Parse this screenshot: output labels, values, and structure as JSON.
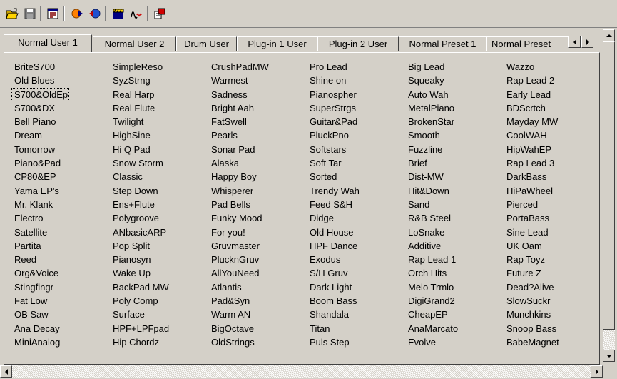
{
  "toolbar": {
    "buttons": [
      {
        "name": "open-folder-icon"
      },
      {
        "name": "save-disk-icon"
      },
      {
        "name": "properties-icon"
      },
      {
        "name": "send-icon"
      },
      {
        "name": "receive-icon"
      },
      {
        "name": "film-clapper-icon"
      },
      {
        "name": "midi-wave-icon"
      },
      {
        "name": "tools-icon"
      }
    ]
  },
  "tabs": [
    {
      "label": "Normal User 1",
      "active": true
    },
    {
      "label": "Normal User 2",
      "active": false
    },
    {
      "label": "Drum User",
      "active": false
    },
    {
      "label": "Plug-in 1 User",
      "active": false
    },
    {
      "label": "Plug-in 2 User",
      "active": false
    },
    {
      "label": "Normal Preset 1",
      "active": false
    },
    {
      "label": "Normal Preset",
      "active": false
    }
  ],
  "columns": [
    [
      "BriteS700",
      "Old Blues",
      "S700&OldEp",
      "S700&DX",
      "Bell Piano",
      "Dream",
      "Tomorrow",
      "Piano&Pad",
      "CP80&EP",
      "Yama EP's",
      "Mr. Klank",
      "Electro",
      "Satellite",
      "Partita",
      "Reed",
      "Org&Voice",
      "Stingfingr",
      "Fat Low",
      "OB Saw",
      "Ana Decay",
      "MiniAnalog"
    ],
    [
      "SimpleReso",
      "SyzStrng",
      "Real Harp",
      "Real Flute",
      "Twilight",
      "HighSine",
      "Hi Q Pad",
      "Snow Storm",
      "Classic",
      "Step Down",
      "Ens+Flute",
      "Polygroove",
      "ANbasicARP",
      "Pop Split",
      "Pianosyn",
      "Wake Up",
      "BackPad MW",
      "Poly Comp",
      "Surface",
      "HPF+LPFpad",
      "Hip Chordz"
    ],
    [
      "CrushPadMW",
      "Warmest",
      "Sadness",
      "Bright Aah",
      "FatSwell",
      "Pearls",
      "Sonar Pad",
      "Alaska",
      "Happy Boy",
      "Whisperer",
      "Pad Bells",
      "Funky Mood",
      "For you!",
      "Gruvmaster",
      "PlucknGruv",
      "AllYouNeed",
      "Atlantis",
      "Pad&Syn",
      "Warm AN",
      "BigOctave",
      "OldStrings"
    ],
    [
      "Pro Lead",
      "Shine on",
      "Pianospher",
      "SuperStrgs",
      "Guitar&Pad",
      "PluckPno",
      "Softstars",
      "Soft Tar",
      "Sorted",
      "Trendy Wah",
      "Feed S&H",
      "Didge",
      "Old House",
      "HPF Dance",
      "Exodus",
      "S/H Gruv",
      "Dark Light",
      "Boom Bass",
      "Shandala",
      "Titan",
      "Puls Step"
    ],
    [
      "Big Lead",
      "Squeaky",
      "Auto Wah",
      "MetalPiano",
      "BrokenStar",
      "Smooth",
      "Fuzzline",
      "Brief",
      "Dist-MW",
      "Hit&Down",
      "Sand",
      "R&B Steel",
      "LoSnake",
      "Additive",
      "Rap Lead 1",
      "Orch Hits",
      "Melo Trmlo",
      "DigiGrand2",
      "CheapEP",
      "AnaMarcato",
      "Evolve"
    ],
    [
      "Wazzo",
      "Rap Lead 2",
      "Early Lead",
      "BDScrtch",
      "Mayday MW",
      "CoolWAH",
      "HipWahEP",
      "Rap Lead 3",
      "DarkBass",
      "HiPaWheel",
      "Pierced",
      "PortaBass",
      "Sine Lead",
      "UK Oam",
      "Rap Toyz",
      "Future Z",
      "Dead?Alive",
      "SlowSuckr",
      "Munchkins",
      "Snoop Bass",
      "BabeMagnet"
    ]
  ],
  "focused_item": "S700&OldEp",
  "colors": {
    "face": "#d4d0c8",
    "highlight": "#ffffff",
    "shadow": "#808080",
    "dark": "#404040"
  }
}
